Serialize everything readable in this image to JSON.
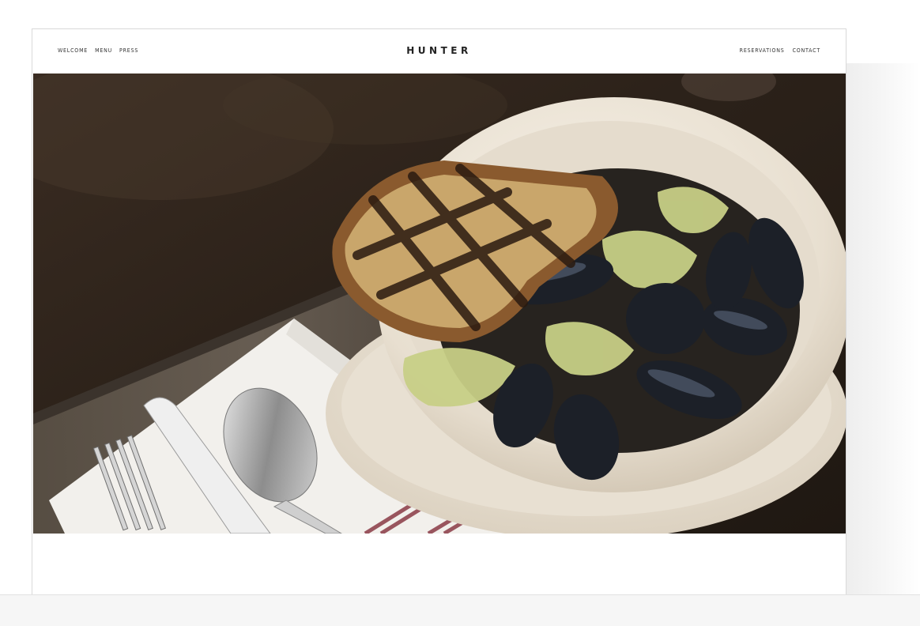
{
  "site": {
    "brand": "HUNTER"
  },
  "nav": {
    "left": [
      {
        "label": "WELCOME"
      },
      {
        "label": "MENU"
      },
      {
        "label": "PRESS"
      }
    ],
    "right": [
      {
        "label": "RESERVATIONS"
      },
      {
        "label": "CONTACT"
      }
    ]
  },
  "hero": {
    "image_subject": "bowl of mussels with grilled bread",
    "colors": {
      "table": "#2b2119",
      "bowl": "#efe8dc",
      "napkin": "#f2f0ec",
      "stripe": "#8a3b46",
      "mussel": "#1c2028",
      "bread": "#8a5a2e"
    }
  }
}
